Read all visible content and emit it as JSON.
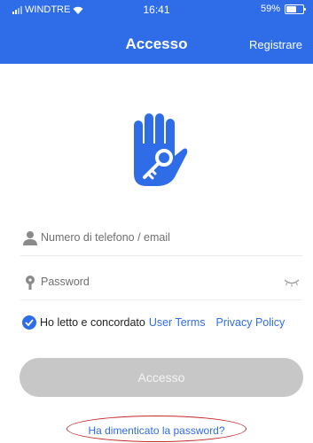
{
  "status_bar": {
    "carrier": "WINDTRE",
    "time": "16:41",
    "battery": "59%",
    "battery_level": 0.59,
    "wifi_icon": "wifi-icon",
    "signal_icon": "signal-icon"
  },
  "header": {
    "title": "Accesso",
    "register_label": "Registrare",
    "background": "#2f6de8"
  },
  "logo": {
    "icon": "hand-key-icon"
  },
  "form": {
    "phone_email": {
      "placeholder": "Numero di telefono / email",
      "icon": "user-icon"
    },
    "password": {
      "placeholder": "Password",
      "icon": "lock-icon",
      "toggle_icon": "eye-closed-icon"
    }
  },
  "agreement": {
    "checked": true,
    "text": "Ho letto e concordato",
    "user_terms": "User Terms",
    "privacy_policy": "Privacy Policy"
  },
  "login_button": {
    "label": "Accesso"
  },
  "forgot_password": {
    "label": "Ha dimenticato la password?"
  },
  "colors": {
    "accent": "#2f6de8",
    "button_disabled": "#c7c7c7",
    "highlight": "#c42a2a"
  }
}
